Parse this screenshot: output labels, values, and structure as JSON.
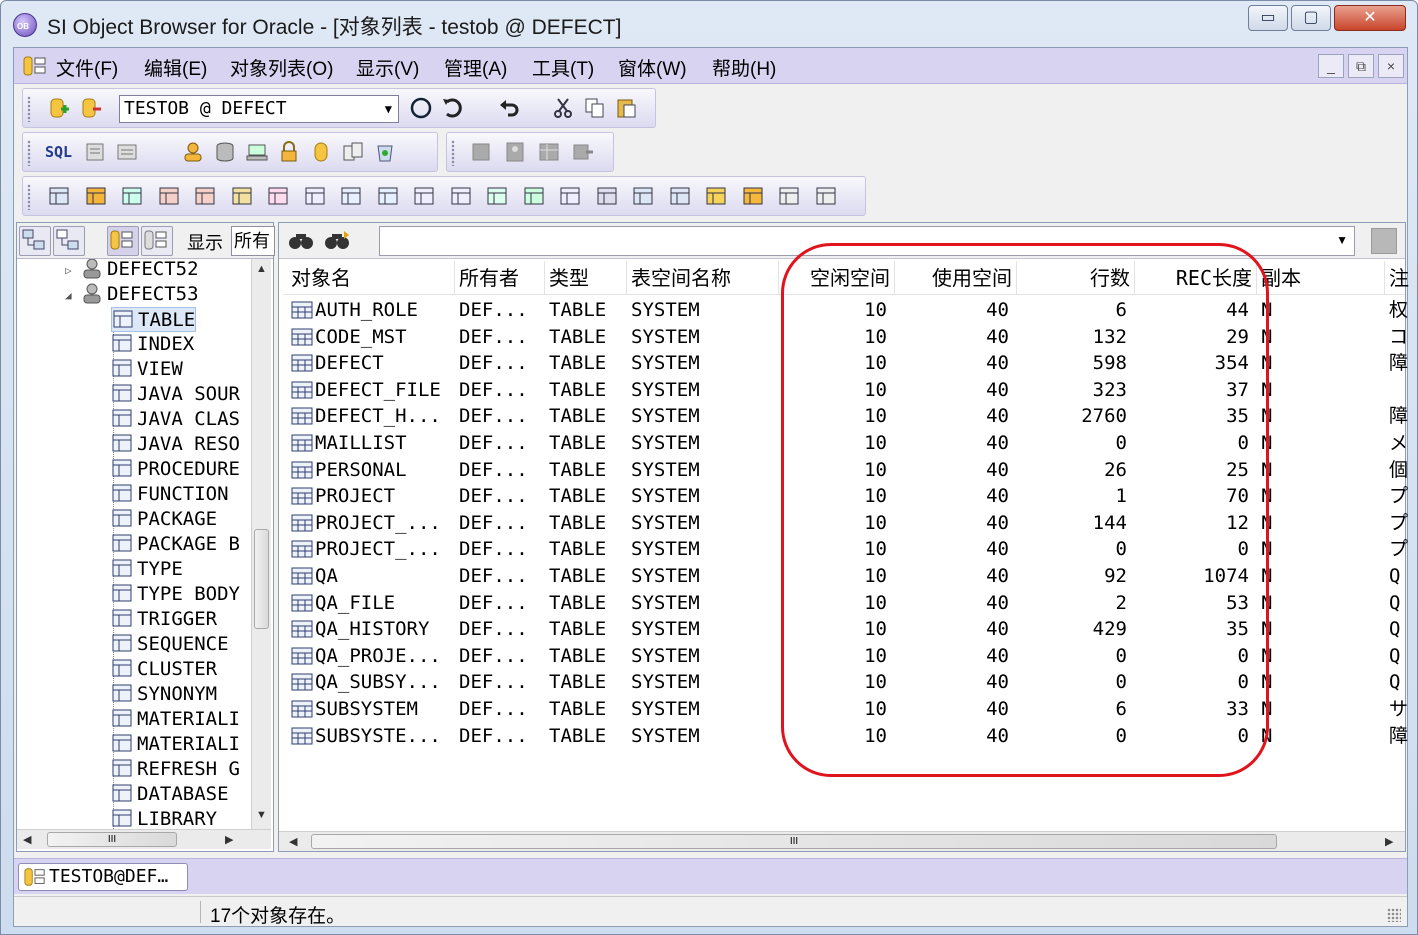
{
  "window": {
    "title": "SI Object Browser for Oracle - [对象列表 - testob @ DEFECT]",
    "minimize_glyph": "▭",
    "maximize_glyph": "▢",
    "close_glyph": "✕"
  },
  "menu": {
    "items": [
      "文件(F)",
      "编辑(E)",
      "对象列表(O)",
      "显示(V)",
      "管理(A)",
      "工具(T)",
      "窗体(W)",
      "帮助(H)"
    ],
    "mdi_minimize": "_",
    "mdi_restore": "⧉",
    "mdi_close": "×"
  },
  "toolbar": {
    "connection": "TESTOB @ DEFECT",
    "sql_label": "SQL"
  },
  "left_panel": {
    "display_label": "显示",
    "filter_value": "所有",
    "tree": [
      {
        "label": "DEFECT52",
        "icon": "user-icon",
        "level": 1,
        "expander": "▷"
      },
      {
        "label": "DEFECT53",
        "icon": "user-icon",
        "level": 1,
        "expander": "◢"
      },
      {
        "label": "TABLE",
        "icon": "table-icon",
        "level": 2,
        "selected": true
      },
      {
        "label": "INDEX",
        "icon": "index-key-icon",
        "level": 2
      },
      {
        "label": "VIEW",
        "icon": "view-icon",
        "level": 2
      },
      {
        "label": "JAVA SOUR",
        "icon": "java-source-icon",
        "level": 2
      },
      {
        "label": "JAVA CLAS",
        "icon": "java-class-icon",
        "level": 2
      },
      {
        "label": "JAVA RESO",
        "icon": "java-resource-icon",
        "level": 2
      },
      {
        "label": "PROCEDURE",
        "icon": "procedure-icon",
        "level": 2
      },
      {
        "label": "FUNCTION",
        "icon": "function-icon",
        "level": 2
      },
      {
        "label": "PACKAGE",
        "icon": "package-icon",
        "level": 2
      },
      {
        "label": "PACKAGE B",
        "icon": "package-body-icon",
        "level": 2
      },
      {
        "label": "TYPE",
        "icon": "type-icon",
        "level": 2
      },
      {
        "label": "TYPE BODY",
        "icon": "type-body-icon",
        "level": 2
      },
      {
        "label": "TRIGGER",
        "icon": "trigger-icon",
        "level": 2
      },
      {
        "label": "SEQUENCE",
        "icon": "sequence-icon",
        "level": 2
      },
      {
        "label": "CLUSTER",
        "icon": "cluster-icon",
        "level": 2
      },
      {
        "label": "SYNONYM",
        "icon": "synonym-icon",
        "level": 2
      },
      {
        "label": "MATERIALI",
        "icon": "materialized-view-icon",
        "level": 2
      },
      {
        "label": "MATERIALI",
        "icon": "materialized-log-icon",
        "level": 2
      },
      {
        "label": "REFRESH G",
        "icon": "refresh-group-icon",
        "level": 2
      },
      {
        "label": "DATABASE",
        "icon": "database-link-icon",
        "level": 2
      },
      {
        "label": "LIBRARY",
        "icon": "library-icon",
        "level": 2
      }
    ]
  },
  "grid": {
    "columns": [
      "对象名",
      "所有者",
      "类型",
      "表空间名称",
      "空闲空间",
      "使用空间",
      "行数",
      "REC长度",
      "副本",
      "注"
    ],
    "rows": [
      [
        "AUTH_ROLE",
        "DEF...",
        "TABLE",
        "SYSTEM",
        "10",
        "40",
        "6",
        "44",
        "N",
        "权"
      ],
      [
        "CODE_MST",
        "DEF...",
        "TABLE",
        "SYSTEM",
        "10",
        "40",
        "132",
        "29",
        "N",
        "コ"
      ],
      [
        "DEFECT",
        "DEF...",
        "TABLE",
        "SYSTEM",
        "10",
        "40",
        "598",
        "354",
        "N",
        "障"
      ],
      [
        "DEFECT_FILE",
        "DEF...",
        "TABLE",
        "SYSTEM",
        "10",
        "40",
        "323",
        "37",
        "N",
        ""
      ],
      [
        "DEFECT_H...",
        "DEF...",
        "TABLE",
        "SYSTEM",
        "10",
        "40",
        "2760",
        "35",
        "N",
        "障"
      ],
      [
        "MAILLIST",
        "DEF...",
        "TABLE",
        "SYSTEM",
        "10",
        "40",
        "0",
        "0",
        "N",
        "メ"
      ],
      [
        "PERSONAL",
        "DEF...",
        "TABLE",
        "SYSTEM",
        "10",
        "40",
        "26",
        "25",
        "N",
        "個"
      ],
      [
        "PROJECT",
        "DEF...",
        "TABLE",
        "SYSTEM",
        "10",
        "40",
        "1",
        "70",
        "N",
        "プ"
      ],
      [
        "PROJECT_...",
        "DEF...",
        "TABLE",
        "SYSTEM",
        "10",
        "40",
        "144",
        "12",
        "N",
        "プ"
      ],
      [
        "PROJECT_...",
        "DEF...",
        "TABLE",
        "SYSTEM",
        "10",
        "40",
        "0",
        "0",
        "N",
        "プ"
      ],
      [
        "QA",
        "DEF...",
        "TABLE",
        "SYSTEM",
        "10",
        "40",
        "92",
        "1074",
        "N",
        "Q"
      ],
      [
        "QA_FILE",
        "DEF...",
        "TABLE",
        "SYSTEM",
        "10",
        "40",
        "2",
        "53",
        "N",
        "Q"
      ],
      [
        "QA_HISTORY",
        "DEF...",
        "TABLE",
        "SYSTEM",
        "10",
        "40",
        "429",
        "35",
        "N",
        "Q"
      ],
      [
        "QA_PROJE...",
        "DEF...",
        "TABLE",
        "SYSTEM",
        "10",
        "40",
        "0",
        "0",
        "N",
        "Q"
      ],
      [
        "QA_SUBSY...",
        "DEF...",
        "TABLE",
        "SYSTEM",
        "10",
        "40",
        "0",
        "0",
        "N",
        "Q"
      ],
      [
        "SUBSYSTEM",
        "DEF...",
        "TABLE",
        "SYSTEM",
        "10",
        "40",
        "6",
        "33",
        "N",
        "サ"
      ],
      [
        "SUBSYSTE...",
        "DEF...",
        "TABLE",
        "SYSTEM",
        "10",
        "40",
        "0",
        "0",
        "N",
        "障"
      ]
    ]
  },
  "scrollbar": {
    "grip": "III",
    "up": "▲",
    "down": "▼",
    "left": "◀",
    "right": "▶"
  },
  "bottom": {
    "doc_tab": "TESTOB@DEF…",
    "status": "17个对象存在。"
  },
  "colors": {
    "menubar": "#d7d3f0",
    "highlight_oval": "#e0141c",
    "selection": "#dde8f7"
  }
}
